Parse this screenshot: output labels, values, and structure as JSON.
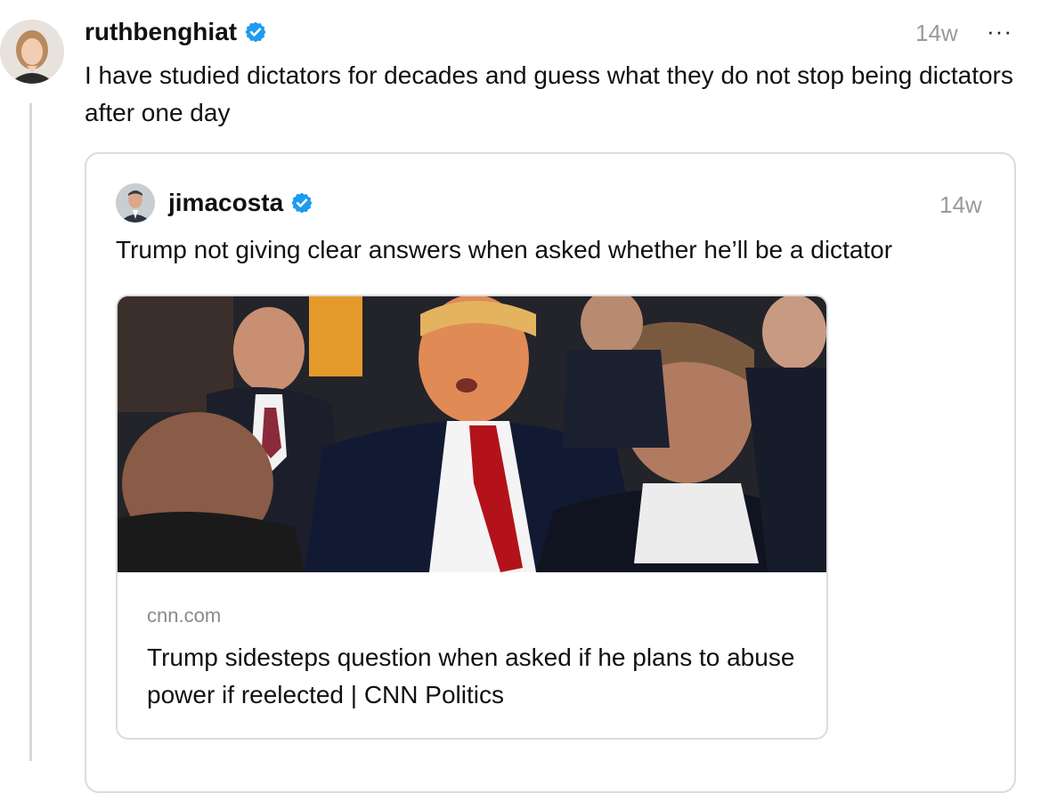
{
  "post": {
    "username": "ruthbenghiat",
    "time": "14w",
    "more_label": "···",
    "text": "I have studied dictators for decades and guess what they do not stop being dictators after one day",
    "verified": true
  },
  "quoted_post": {
    "username": "jimacosta",
    "time": "14w",
    "text": "Trump not giving clear answers when asked whether he’ll be a dictator",
    "verified": true,
    "link_card": {
      "domain": "cnn.com",
      "headline": "Trump sidesteps question when asked if he plans to abuse power if reelected | CNN Politics"
    }
  },
  "colors": {
    "verified_blue": "#1d9bf0",
    "muted_text": "#9a9a9a",
    "border": "#dcdcdc",
    "thread_line": "#d8d8d8"
  }
}
